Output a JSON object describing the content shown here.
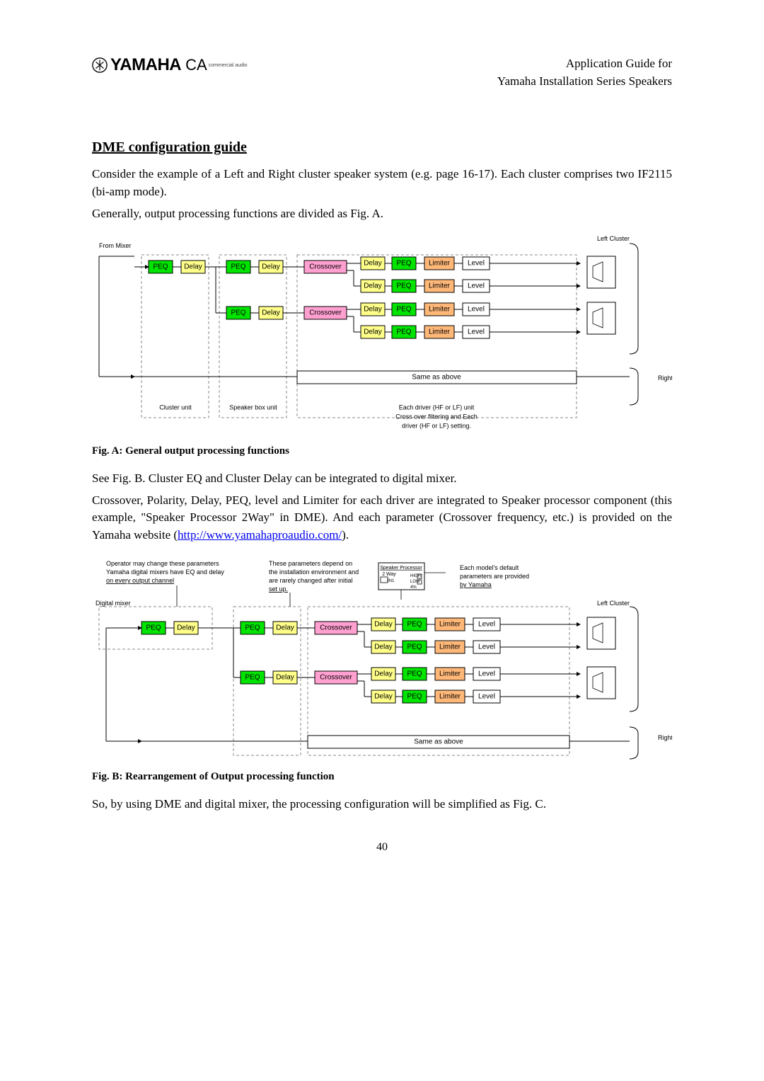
{
  "header": {
    "brand_text": "YAMAHA",
    "ca_mark": "CA",
    "ca_sub": "commercial audio",
    "line1": "Application Guide for",
    "line2": "Yamaha Installation Series Speakers"
  },
  "section_title": "DME configuration guide",
  "p1": "Consider the example of a Left and Right cluster speaker system (e.g. page 16-17). Each cluster comprises two IF2115 (bi-amp mode).",
  "p2": "Generally, output processing functions are divided as Fig. A.",
  "figA": {
    "caption": "Fig. A: General output processing functions",
    "from_mixer": "From Mixer",
    "left_cluster": "Left Cluster",
    "right_cluster": "Right Cluster",
    "same_as_above": "Same as above",
    "unit_labels": {
      "cluster": "Cluster unit",
      "speaker": "Speaker box unit",
      "driver1": "Each driver (HF or LF) unit",
      "driver2": "Cross over filtering and Each",
      "driver3": "driver (HF or LF) setting."
    },
    "blk": {
      "peq": "PEQ",
      "delay": "Delay",
      "crossover": "Crossover",
      "limiter": "Limiter",
      "level": "Level"
    }
  },
  "p3": "See Fig. B. Cluster EQ and Cluster Delay can be integrated to digital mixer.",
  "p4a": "Crossover, Polarity, Delay, PEQ, level and Limiter for each driver are integrated to Speaker processor component (this example, \"Speaker Processor 2Way\" in DME). And each parameter (Crossover frequency, etc.) is provided on the Yamaha website (",
  "p4_link": "http://www.yamahaproaudio.com/",
  "p4b": ").",
  "figB": {
    "caption": "Fig. B: Rearrangement of Output processing function",
    "digital_mixer": "Digital mixer",
    "left_cluster": "Left Cluster",
    "right_cluster": "Right Cluster",
    "same_as_above": "Same as above",
    "note1a": "Operator may change these parameters",
    "note1b": "Yamaha digital mixers have EQ and delay",
    "note1c": "on every output channel",
    "note2a": "These parameters depend on",
    "note2b": "the installation environment and",
    "note2c": "are rarely changed after initial",
    "note2d": "set up.",
    "note3a": "Each model's default",
    "note3b": "parameters are provided",
    "note3c": "by Yamaha",
    "sp_box": {
      "t1": "Speaker Processor",
      "t2": "2 Way",
      "t3": "IN1",
      "t4": "HIGH",
      "t5": "LOW",
      "t6": "4%"
    },
    "blk": {
      "peq": "PEQ",
      "delay": "Delay",
      "crossover": "Crossover",
      "limiter": "Limiter",
      "level": "Level"
    }
  },
  "p5": "So, by using DME and digital mixer, the processing configuration will be simplified as Fig. C.",
  "page_number": "40"
}
